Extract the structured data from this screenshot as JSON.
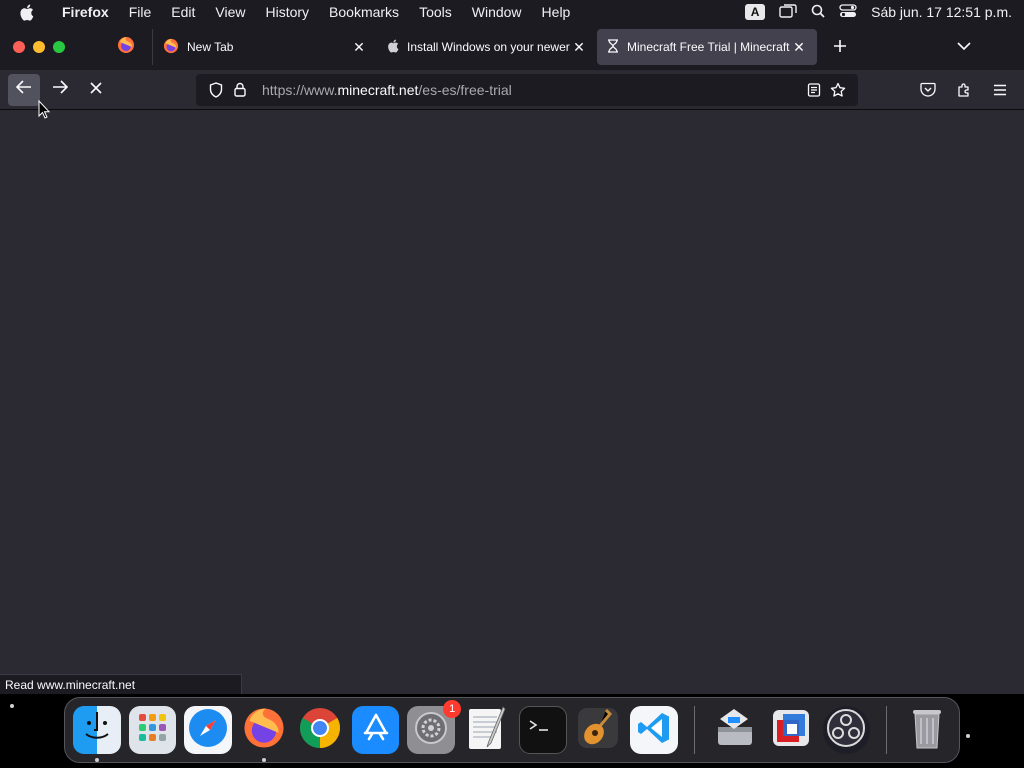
{
  "menubar": {
    "app_name": "Firefox",
    "items": [
      "File",
      "Edit",
      "View",
      "History",
      "Bookmarks",
      "Tools",
      "Window",
      "Help"
    ],
    "input_source": "A",
    "clock": "Sáb jun. 17  12:51 p.m."
  },
  "tabs": [
    {
      "title": "New Tab",
      "icon": "firefox-icon"
    },
    {
      "title": "Install Windows on your newer M",
      "icon": "apple-icon"
    },
    {
      "title": "Minecraft Free Trial | Minecraft",
      "icon": "loading-hourglass-icon",
      "active": true
    }
  ],
  "urlbar": {
    "prefix": "https://www.",
    "domain": "minecraft.net",
    "path": "/es-es/free-trial"
  },
  "statusbar": {
    "text": "Read www.minecraft.net"
  },
  "dock": {
    "badge_settings": "1",
    "apps": [
      "Finder",
      "Launchpad",
      "Safari",
      "Firefox",
      "Chrome",
      "App Store",
      "System Settings",
      "TextEdit",
      "Terminal",
      "GarageBand",
      "Visual Studio Code",
      "Boot Camp Assistant",
      "Parallels",
      "OBS",
      "Trash"
    ]
  },
  "colors": {
    "toolbar": "#2b2a33",
    "tabstrip": "#1c1b22",
    "active_tab": "#42414d"
  }
}
